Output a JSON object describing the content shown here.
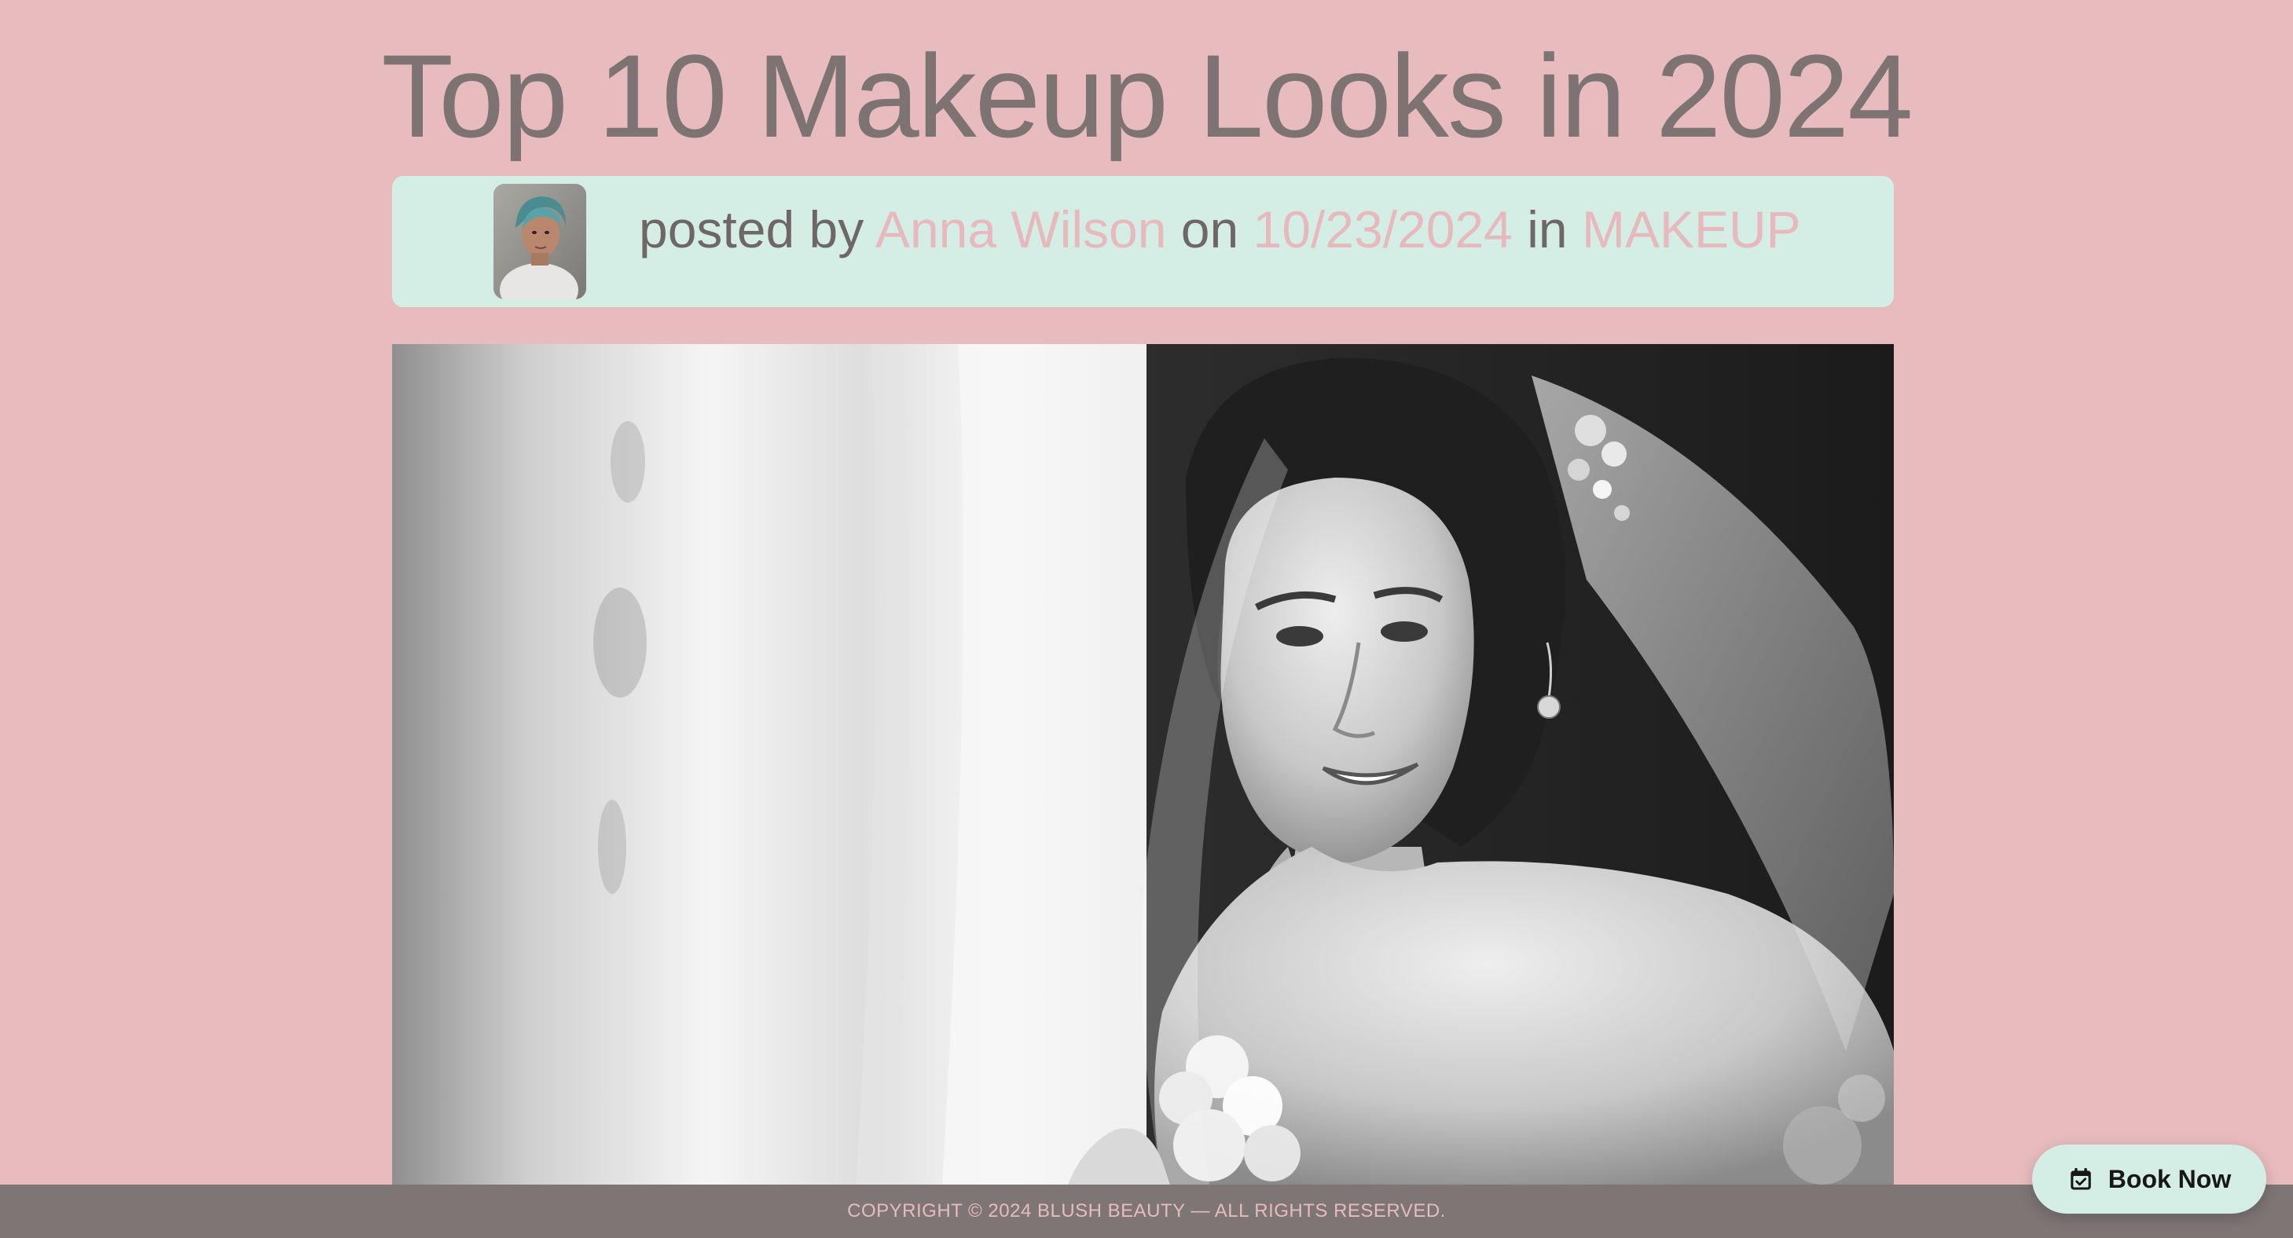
{
  "post": {
    "title": "Top 10 Makeup Looks in 2024",
    "meta": {
      "posted_by_label": "posted by",
      "author": "Anna Wilson",
      "on_label": "on",
      "date": "10/23/2024",
      "in_label": "in",
      "category": "MAKEUP"
    },
    "avatar_icon": "author-avatar-photo",
    "hero_image_icon": "bride-photo"
  },
  "footer": {
    "copyright": "COPYRIGHT © 2024 BLUSH BEAUTY — ALL RIGHTS RESERVED."
  },
  "book_now": {
    "label": "Book Now",
    "icon": "calendar-check-icon"
  },
  "colors": {
    "background": "#e8bbbe",
    "meta_background": "#d4eee5",
    "accent": "#e7b8bc",
    "title_text": "#7d7373",
    "footer_background": "#7e7575"
  }
}
